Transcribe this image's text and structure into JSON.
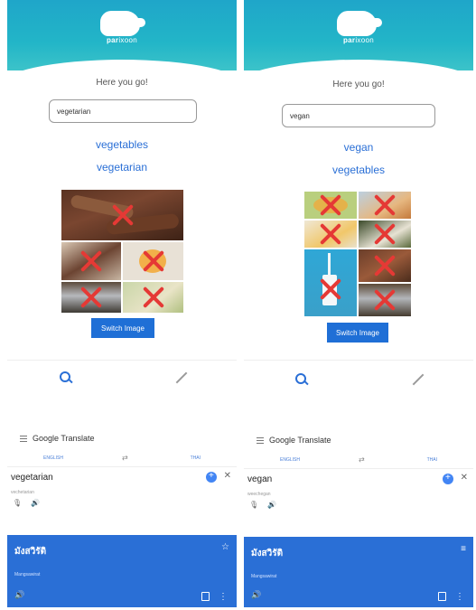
{
  "left": {
    "header": {
      "brand_a": "par",
      "brand_b": "ixoon"
    },
    "heading": "Here you go!",
    "search": {
      "value": "vegetarian"
    },
    "suggestions": [
      "vegetables",
      "vegetarian"
    ],
    "switch_label": "Switch Image",
    "translate": {
      "app": "Google Translate",
      "lang_from": "ENGLISH",
      "lang_to": "THAI",
      "input": "vegetarian",
      "transliteration": "vechetarian",
      "result": "มังสวิรัติ",
      "result_roman": "Mangsawirat"
    }
  },
  "right": {
    "header": {
      "brand_a": "par",
      "brand_b": "ixoon"
    },
    "heading": "Here you go!",
    "search": {
      "value": "vegan"
    },
    "suggestions": [
      "vegan",
      "vegetables"
    ],
    "switch_label": "Switch Image",
    "translate": {
      "app": "Google Translate",
      "lang_from": "ENGLISH",
      "lang_to": "THAI",
      "input": "vegan",
      "transliteration": "weechegan",
      "result": "มังสวิรัติ",
      "result_roman": "Mangsawirat"
    }
  },
  "colors": {
    "header": "#22b5c8",
    "link": "#2a6fd6",
    "button": "#1f6fd6",
    "cross": "#e53935"
  },
  "icons": {
    "search": "search-icon",
    "edit": "pencil-icon",
    "menu": "hamburger-icon",
    "mic": "mic-icon",
    "speaker": "speaker-icon",
    "copy": "copy-icon",
    "star": "star-icon",
    "more": "more-vert-icon"
  }
}
